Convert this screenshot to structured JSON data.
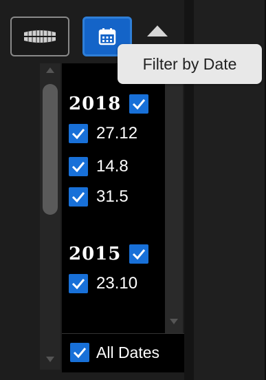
{
  "toolbar": {
    "teeth_button_icon": "teeth-icon",
    "date_button_icon": "calendar-icon",
    "collapse_icon": "chevron-up-icon"
  },
  "tooltip": {
    "text": "Filter by Date"
  },
  "date_filter": {
    "groups": [
      {
        "year": "2018",
        "checked": true,
        "dates": [
          {
            "label": "27.12",
            "checked": true
          },
          {
            "label": "14.8",
            "checked": true
          },
          {
            "label": "31.5",
            "checked": true
          }
        ]
      },
      {
        "year": "2015",
        "checked": true,
        "dates": [
          {
            "label": "23.10",
            "checked": true
          }
        ]
      }
    ],
    "all_dates": {
      "label": "All Dates",
      "checked": true
    }
  },
  "colors": {
    "accent": "#1870d8",
    "button_active": "#1464c8",
    "background": "#1d1d1d"
  }
}
